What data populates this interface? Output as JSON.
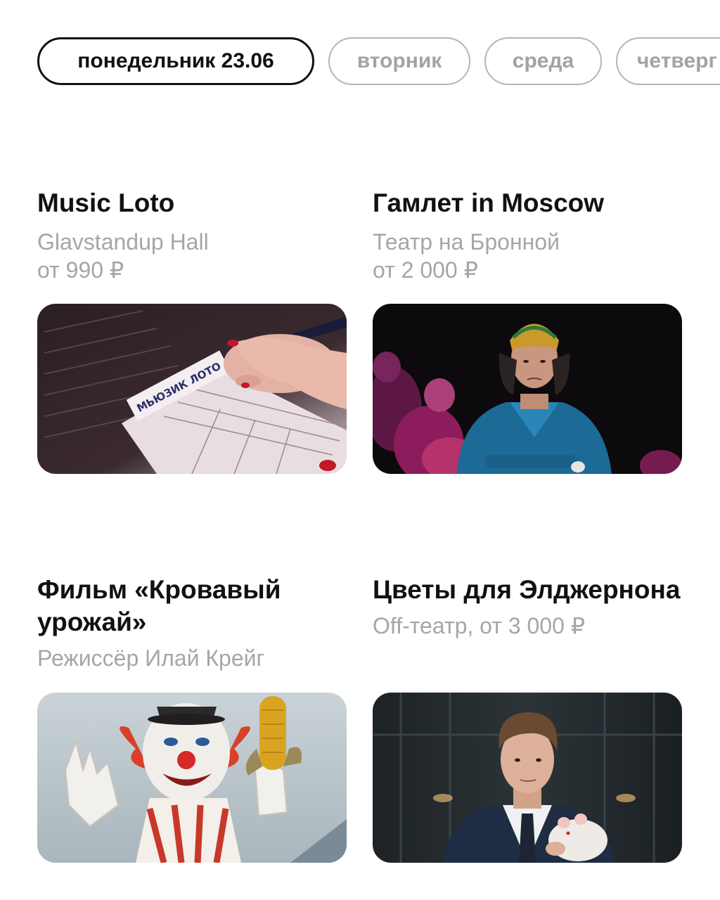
{
  "day_tabs": [
    {
      "label": "понедельник 23.06",
      "active": true
    },
    {
      "label": "вторник",
      "active": false
    },
    {
      "label": "среда",
      "active": false
    },
    {
      "label": "четверг",
      "active": false
    }
  ],
  "events": [
    {
      "title": "Music Loto",
      "venue": "Glavstandup Hall",
      "price": "от 990 ₽",
      "ticket_text": "МЬЮЗИК ЛОТО"
    },
    {
      "title": "Гамлет in Moscow",
      "venue": "Театр на Бронной",
      "price": "от 2 000 ₽"
    },
    {
      "title": "Фильм «Кровавый урожай»",
      "subtitle": "Режиссёр Илай Крейг"
    },
    {
      "title": "Цветы для Элджернона",
      "subtitle": "Off-театр, от 3 000 ₽"
    }
  ]
}
